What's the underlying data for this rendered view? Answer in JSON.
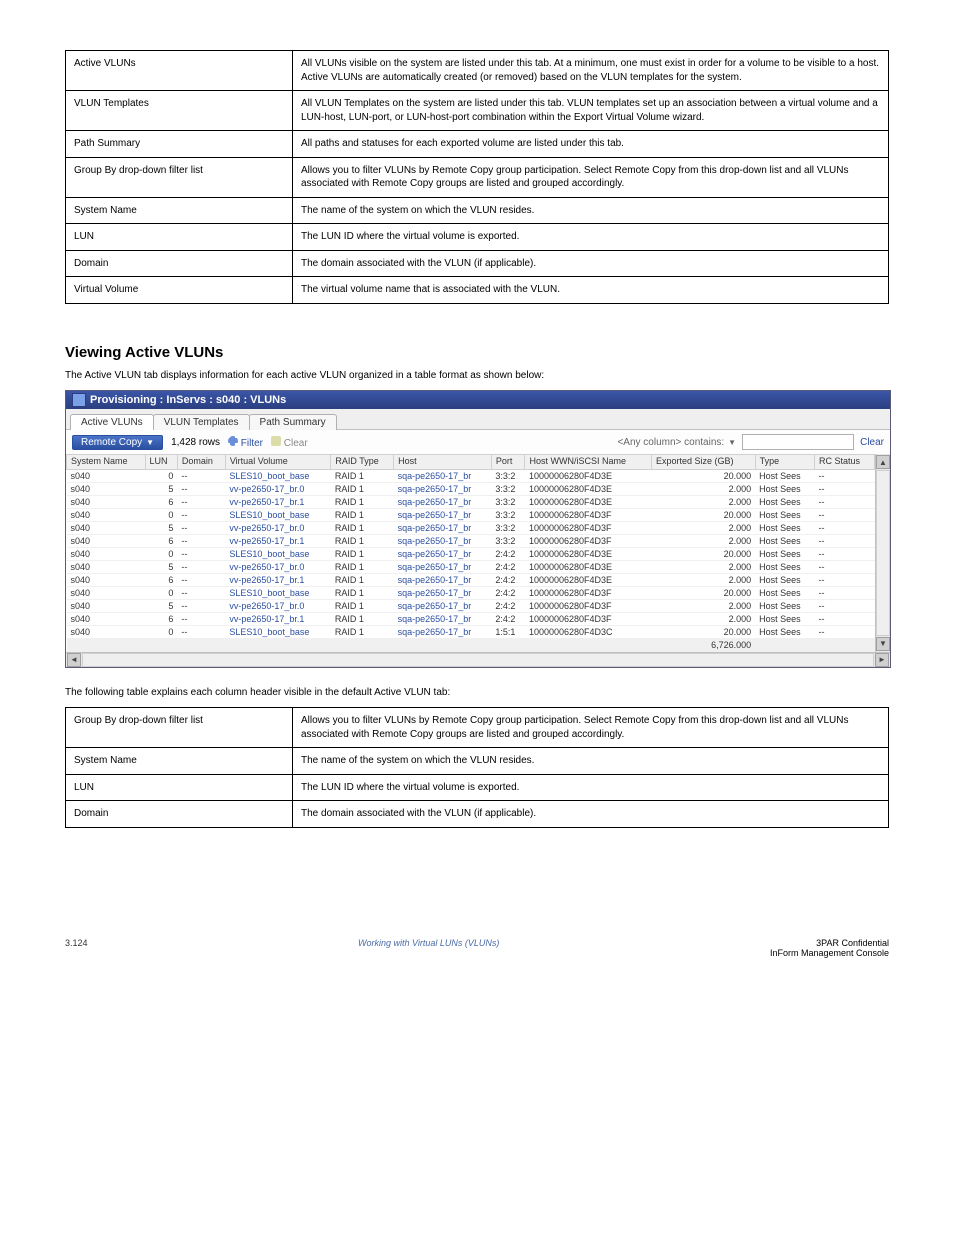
{
  "glossary1": [
    {
      "term": "Active VLUNs",
      "desc": "All VLUNs visible on the system are listed under this tab. At a minimum, one must exist in order for a volume to be visible to a host. Active VLUNs are automatically created (or removed) based on the VLUN templates for the system."
    },
    {
      "term": "VLUN Templates",
      "desc": "All VLUN Templates on the system are listed under this tab. VLUN templates set up an association between a virtual volume and a LUN-host, LUN-port, or LUN-host-port combination within the Export Virtual Volume wizard."
    },
    {
      "term": "Path Summary",
      "desc": "All paths and statuses for each exported volume are listed under this tab."
    },
    {
      "term": "Group By drop-down filter list",
      "desc": "Allows you to filter VLUNs by Remote Copy group participation. Select Remote Copy from this drop-down list and all VLUNs associated with Remote Copy groups are listed and grouped accordingly."
    },
    {
      "term": "System Name",
      "desc": "The name of the system on which the VLUN resides."
    },
    {
      "term": "LUN",
      "desc": "The LUN ID where the virtual volume is exported."
    },
    {
      "term": "Domain",
      "desc": "The domain associated with the VLUN (if applicable)."
    },
    {
      "term": "Virtual Volume",
      "desc": "The virtual volume name that is associated with the VLUN."
    }
  ],
  "sectionHeading": "Viewing Active VLUNs",
  "sectionPara": "The Active VLUN tab displays information for each active VLUN organized in a table format as shown below:",
  "panel": {
    "title": "Provisioning : InServs : s040 : VLUNs",
    "tabs": [
      "Active VLUNs",
      "VLUN Templates",
      "Path Summary"
    ],
    "activeTab": 0,
    "groupBy": "Remote Copy",
    "rowCountLabel": "1,428 rows",
    "filterLabel": "Filter",
    "clearLabel": "Clear",
    "anyColLabel": "<Any column> contains:",
    "clearRight": "Clear",
    "columns": [
      "System Name",
      "LUN",
      "Domain",
      "Virtual Volume",
      "RAID Type",
      "Host",
      "Port",
      "Host WWN/iSCSI Name",
      "Exported Size (GB)",
      "Type",
      "RC Status"
    ],
    "rows": [
      {
        "sys": "s040",
        "lun": "0",
        "dom": "--",
        "vv": "SLES10_boot_base",
        "raid": "RAID 1",
        "host": "sqa-pe2650-17_br",
        "port": "3:3:2",
        "wwn": "10000006280F4D3E",
        "size": "20.000",
        "type": "Host Sees",
        "rc": "--"
      },
      {
        "sys": "s040",
        "lun": "5",
        "dom": "--",
        "vv": "vv-pe2650-17_br.0",
        "raid": "RAID 1",
        "host": "sqa-pe2650-17_br",
        "port": "3:3:2",
        "wwn": "10000006280F4D3E",
        "size": "2.000",
        "type": "Host Sees",
        "rc": "--"
      },
      {
        "sys": "s040",
        "lun": "6",
        "dom": "--",
        "vv": "vv-pe2650-17_br.1",
        "raid": "RAID 1",
        "host": "sqa-pe2650-17_br",
        "port": "3:3:2",
        "wwn": "10000006280F4D3E",
        "size": "2.000",
        "type": "Host Sees",
        "rc": "--"
      },
      {
        "sys": "s040",
        "lun": "0",
        "dom": "--",
        "vv": "SLES10_boot_base",
        "raid": "RAID 1",
        "host": "sqa-pe2650-17_br",
        "port": "3:3:2",
        "wwn": "10000006280F4D3F",
        "size": "20.000",
        "type": "Host Sees",
        "rc": "--"
      },
      {
        "sys": "s040",
        "lun": "5",
        "dom": "--",
        "vv": "vv-pe2650-17_br.0",
        "raid": "RAID 1",
        "host": "sqa-pe2650-17_br",
        "port": "3:3:2",
        "wwn": "10000006280F4D3F",
        "size": "2.000",
        "type": "Host Sees",
        "rc": "--"
      },
      {
        "sys": "s040",
        "lun": "6",
        "dom": "--",
        "vv": "vv-pe2650-17_br.1",
        "raid": "RAID 1",
        "host": "sqa-pe2650-17_br",
        "port": "3:3:2",
        "wwn": "10000006280F4D3F",
        "size": "2.000",
        "type": "Host Sees",
        "rc": "--"
      },
      {
        "sys": "s040",
        "lun": "0",
        "dom": "--",
        "vv": "SLES10_boot_base",
        "raid": "RAID 1",
        "host": "sqa-pe2650-17_br",
        "port": "2:4:2",
        "wwn": "10000006280F4D3E",
        "size": "20.000",
        "type": "Host Sees",
        "rc": "--"
      },
      {
        "sys": "s040",
        "lun": "5",
        "dom": "--",
        "vv": "vv-pe2650-17_br.0",
        "raid": "RAID 1",
        "host": "sqa-pe2650-17_br",
        "port": "2:4:2",
        "wwn": "10000006280F4D3E",
        "size": "2.000",
        "type": "Host Sees",
        "rc": "--"
      },
      {
        "sys": "s040",
        "lun": "6",
        "dom": "--",
        "vv": "vv-pe2650-17_br.1",
        "raid": "RAID 1",
        "host": "sqa-pe2650-17_br",
        "port": "2:4:2",
        "wwn": "10000006280F4D3E",
        "size": "2.000",
        "type": "Host Sees",
        "rc": "--"
      },
      {
        "sys": "s040",
        "lun": "0",
        "dom": "--",
        "vv": "SLES10_boot_base",
        "raid": "RAID 1",
        "host": "sqa-pe2650-17_br",
        "port": "2:4:2",
        "wwn": "10000006280F4D3F",
        "size": "20.000",
        "type": "Host Sees",
        "rc": "--"
      },
      {
        "sys": "s040",
        "lun": "5",
        "dom": "--",
        "vv": "vv-pe2650-17_br.0",
        "raid": "RAID 1",
        "host": "sqa-pe2650-17_br",
        "port": "2:4:2",
        "wwn": "10000006280F4D3F",
        "size": "2.000",
        "type": "Host Sees",
        "rc": "--"
      },
      {
        "sys": "s040",
        "lun": "6",
        "dom": "--",
        "vv": "vv-pe2650-17_br.1",
        "raid": "RAID 1",
        "host": "sqa-pe2650-17_br",
        "port": "2:4:2",
        "wwn": "10000006280F4D3F",
        "size": "2.000",
        "type": "Host Sees",
        "rc": "--"
      },
      {
        "sys": "s040",
        "lun": "0",
        "dom": "--",
        "vv": "SLES10_boot_base",
        "raid": "RAID 1",
        "host": "sqa-pe2650-17_br",
        "port": "1:5:1",
        "wwn": "10000006280F4D3C",
        "size": "20.000",
        "type": "Host Sees",
        "rc": "--"
      }
    ],
    "totalSize": "6,726.000"
  },
  "glossary2sentence": "The following table explains each column header visible in the default Active VLUN tab:",
  "glossary2": [
    {
      "term": "Group By drop-down filter list",
      "desc": "Allows you to filter VLUNs by Remote Copy group participation. Select Remote Copy from this drop-down list and all VLUNs associated with Remote Copy groups are listed and grouped accordingly."
    },
    {
      "term": "System Name",
      "desc": "The name of the system on which the VLUN resides."
    },
    {
      "term": "LUN",
      "desc": "The LUN ID where the virtual volume is exported."
    },
    {
      "term": "Domain",
      "desc": "The domain associated with the VLUN (if applicable)."
    }
  ],
  "footer": {
    "left": "3.124",
    "center": "Working with Virtual LUNs (VLUNs)",
    "rightLine1": "3PAR Confidential",
    "rightLine2": "InForm Management Console"
  }
}
